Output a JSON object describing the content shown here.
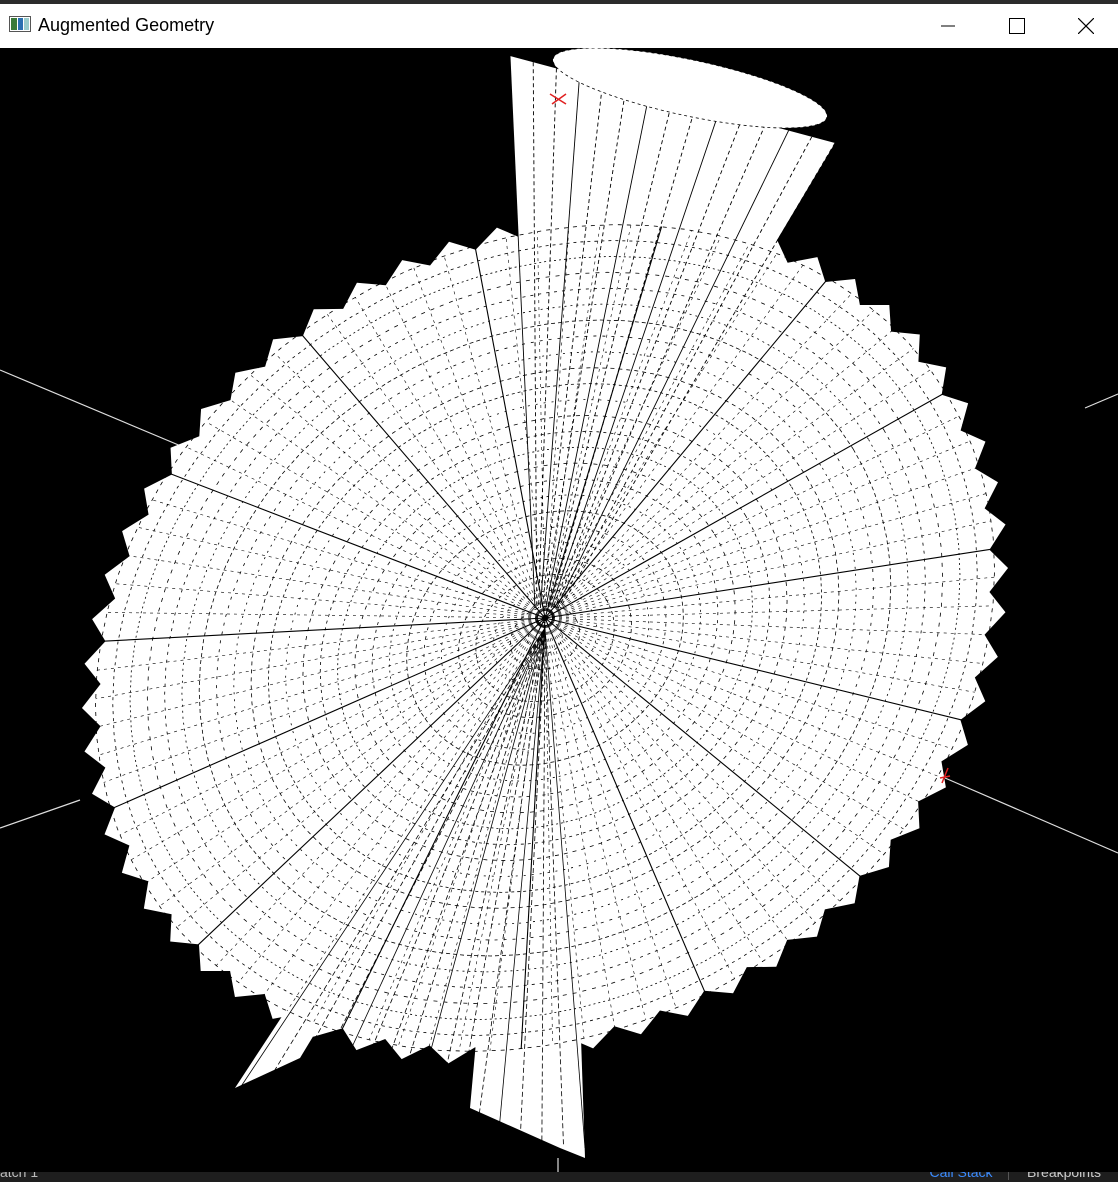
{
  "window": {
    "title": "Augmented Geometry",
    "controls": {
      "minimize": "minimize",
      "maximize": "maximize",
      "close": "close"
    }
  },
  "viewport": {
    "background": "#000000",
    "mesh_color": "#ffffff",
    "line_color": "#000000",
    "marker_color": "#e02020"
  },
  "statusbar": {
    "left_text": "atch 1",
    "active_tab": "Call Stack",
    "tab": "Breakpoints"
  }
}
